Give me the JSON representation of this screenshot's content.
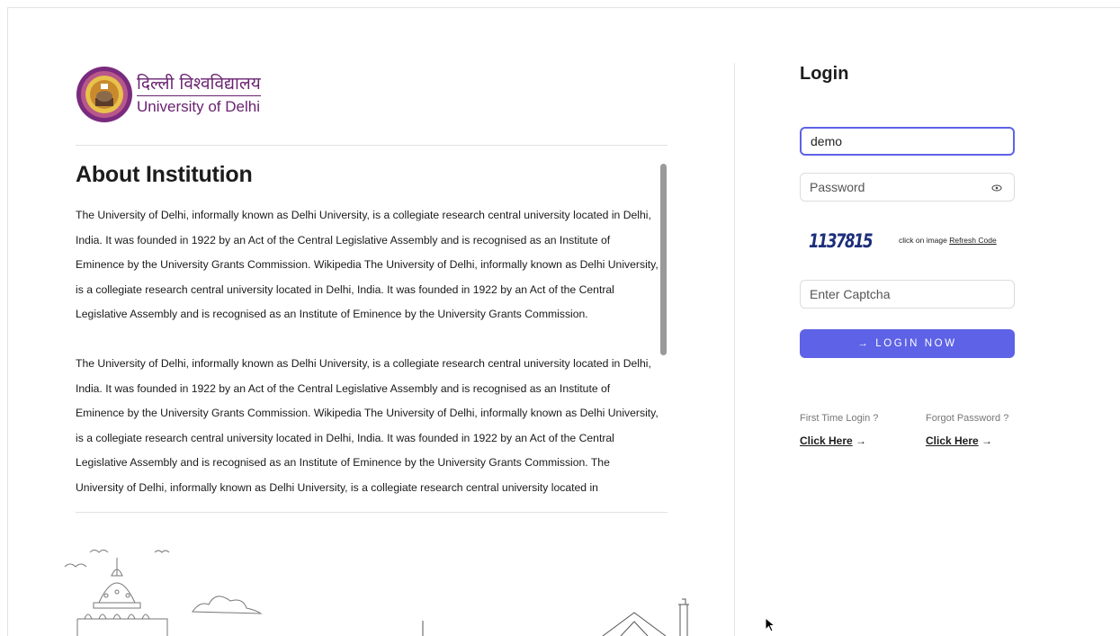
{
  "logo": {
    "hindi": "दिल्ली विश्वविद्यालय",
    "english": "University of Delhi"
  },
  "about": {
    "title": "About Institution",
    "paragraphs": [
      "The University of Delhi, informally known as Delhi University, is a collegiate research central university located in Delhi, India. It was founded in 1922 by an Act of the Central Legislative Assembly and is recognised as an Institute of Eminence by the University Grants Commission. Wikipedia The University of Delhi, informally known as Delhi University, is a collegiate research central university located in Delhi, India. It was founded in 1922 by an Act of the Central Legislative Assembly and is recognised as an Institute of Eminence by the University Grants Commission.",
      "The University of Delhi, informally known as Delhi University, is a collegiate research central university located in Delhi, India. It was founded in 1922 by an Act of the Central Legislative Assembly and is recognised as an Institute of Eminence by the University Grants Commission. Wikipedia The University of Delhi, informally known as Delhi University, is a collegiate research central university located in Delhi, India. It was founded in 1922 by an Act of the Central Legislative Assembly and is recognised as an Institute of Eminence by the University Grants Commission. The University of Delhi, informally known as Delhi University, is a collegiate research central university located in"
    ]
  },
  "login": {
    "title": "Login",
    "username_value": "demo",
    "password_placeholder": "Password",
    "captcha_code": "1137815",
    "captcha_hint": "click on image",
    "refresh_label": "Refresh Code",
    "captcha_placeholder": "Enter Captcha",
    "submit_label": "→ LOGIN NOW",
    "first_time_label": "First Time Login ?",
    "first_time_link": "Click Here",
    "forgot_label": "Forgot Password ?",
    "forgot_link": "Click Here",
    "link_arrow": "→"
  },
  "colors": {
    "accent": "#5d62e6",
    "brand": "#6a2270"
  },
  "icons": [
    "university-seal-icon",
    "eye-icon",
    "mouse-cursor-icon"
  ]
}
